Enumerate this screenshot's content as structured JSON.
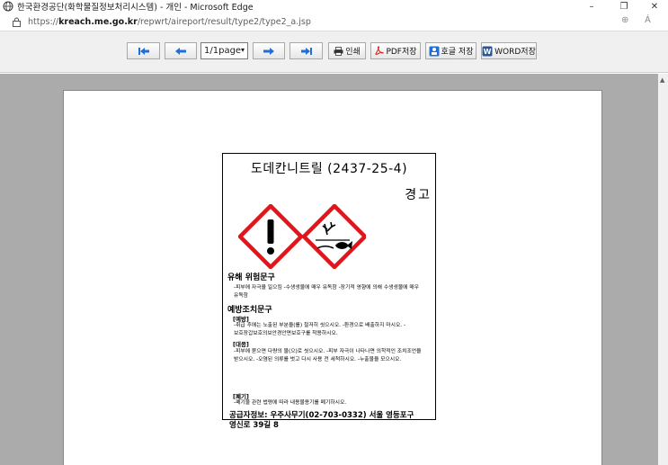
{
  "window": {
    "title": "한국환경공단(화학물질정보처리시스템) - 개인 - Microsoft Edge",
    "minimize_icon": "–",
    "restore_icon": "❐",
    "close_icon": "✕"
  },
  "address_bar": {
    "url_prefix": "https://",
    "url_host": "kreach.me.go.kr",
    "url_path": "/repwrt/aireport/result/type2/type2_a.jsp",
    "zoom_icon": "⊕",
    "read_aloud_icon": "Á"
  },
  "toolbar": {
    "page_select_value": "1/1page",
    "page_select_options": [
      "1/1page"
    ],
    "print_label": "인쇄",
    "pdf_label": "PDF저장",
    "hwp_label": "호글 저장",
    "word_label": "WORD저장"
  },
  "msds_label": {
    "title": "도데칸니트릴 (2437-25-4)",
    "signal_word": "경고",
    "hazard_heading": "유해 위험문구",
    "hazard_text": "-피부에 자극을 일으킴 -수생생물에 매우 유독함 -장기적 영향에 의해 수생생물에 매우 유독함",
    "precaution_heading": "예방조치문구",
    "prevention_heading": "[예방]",
    "prevention_text": "-취급 후에는 노출된 부분을(를) 철저히 씻으시오. -환경으로 배출하지 마시오. -보호장갑보호의보안경안면보호구를 착용하시오.",
    "response_heading": "[대응]",
    "response_text": "-피부에 묻으면 다량의 물(으)로 씻으시오. -피부 자극이 나타나면 의학적인 조치조언을 받으시오. -오염된 의류를 벗고 다시 사용 전 세척하시오. -누출물을 모으시오.",
    "disposal_heading": "[폐기]",
    "disposal_text": "-폐기물 관련 법령에 따라 내용물용기를 폐기하시오.",
    "supplier_line1": "공급자정보: 우주사무기(02-703-0332) 서울 영등포구",
    "supplier_line2": "영신로 39길 8"
  },
  "colors": {
    "viewer_bg": "#ababab",
    "toolbar_bg": "#f0f0f0",
    "ghs_red": "#e0161c",
    "nav_blue": "#1e6fd9"
  }
}
